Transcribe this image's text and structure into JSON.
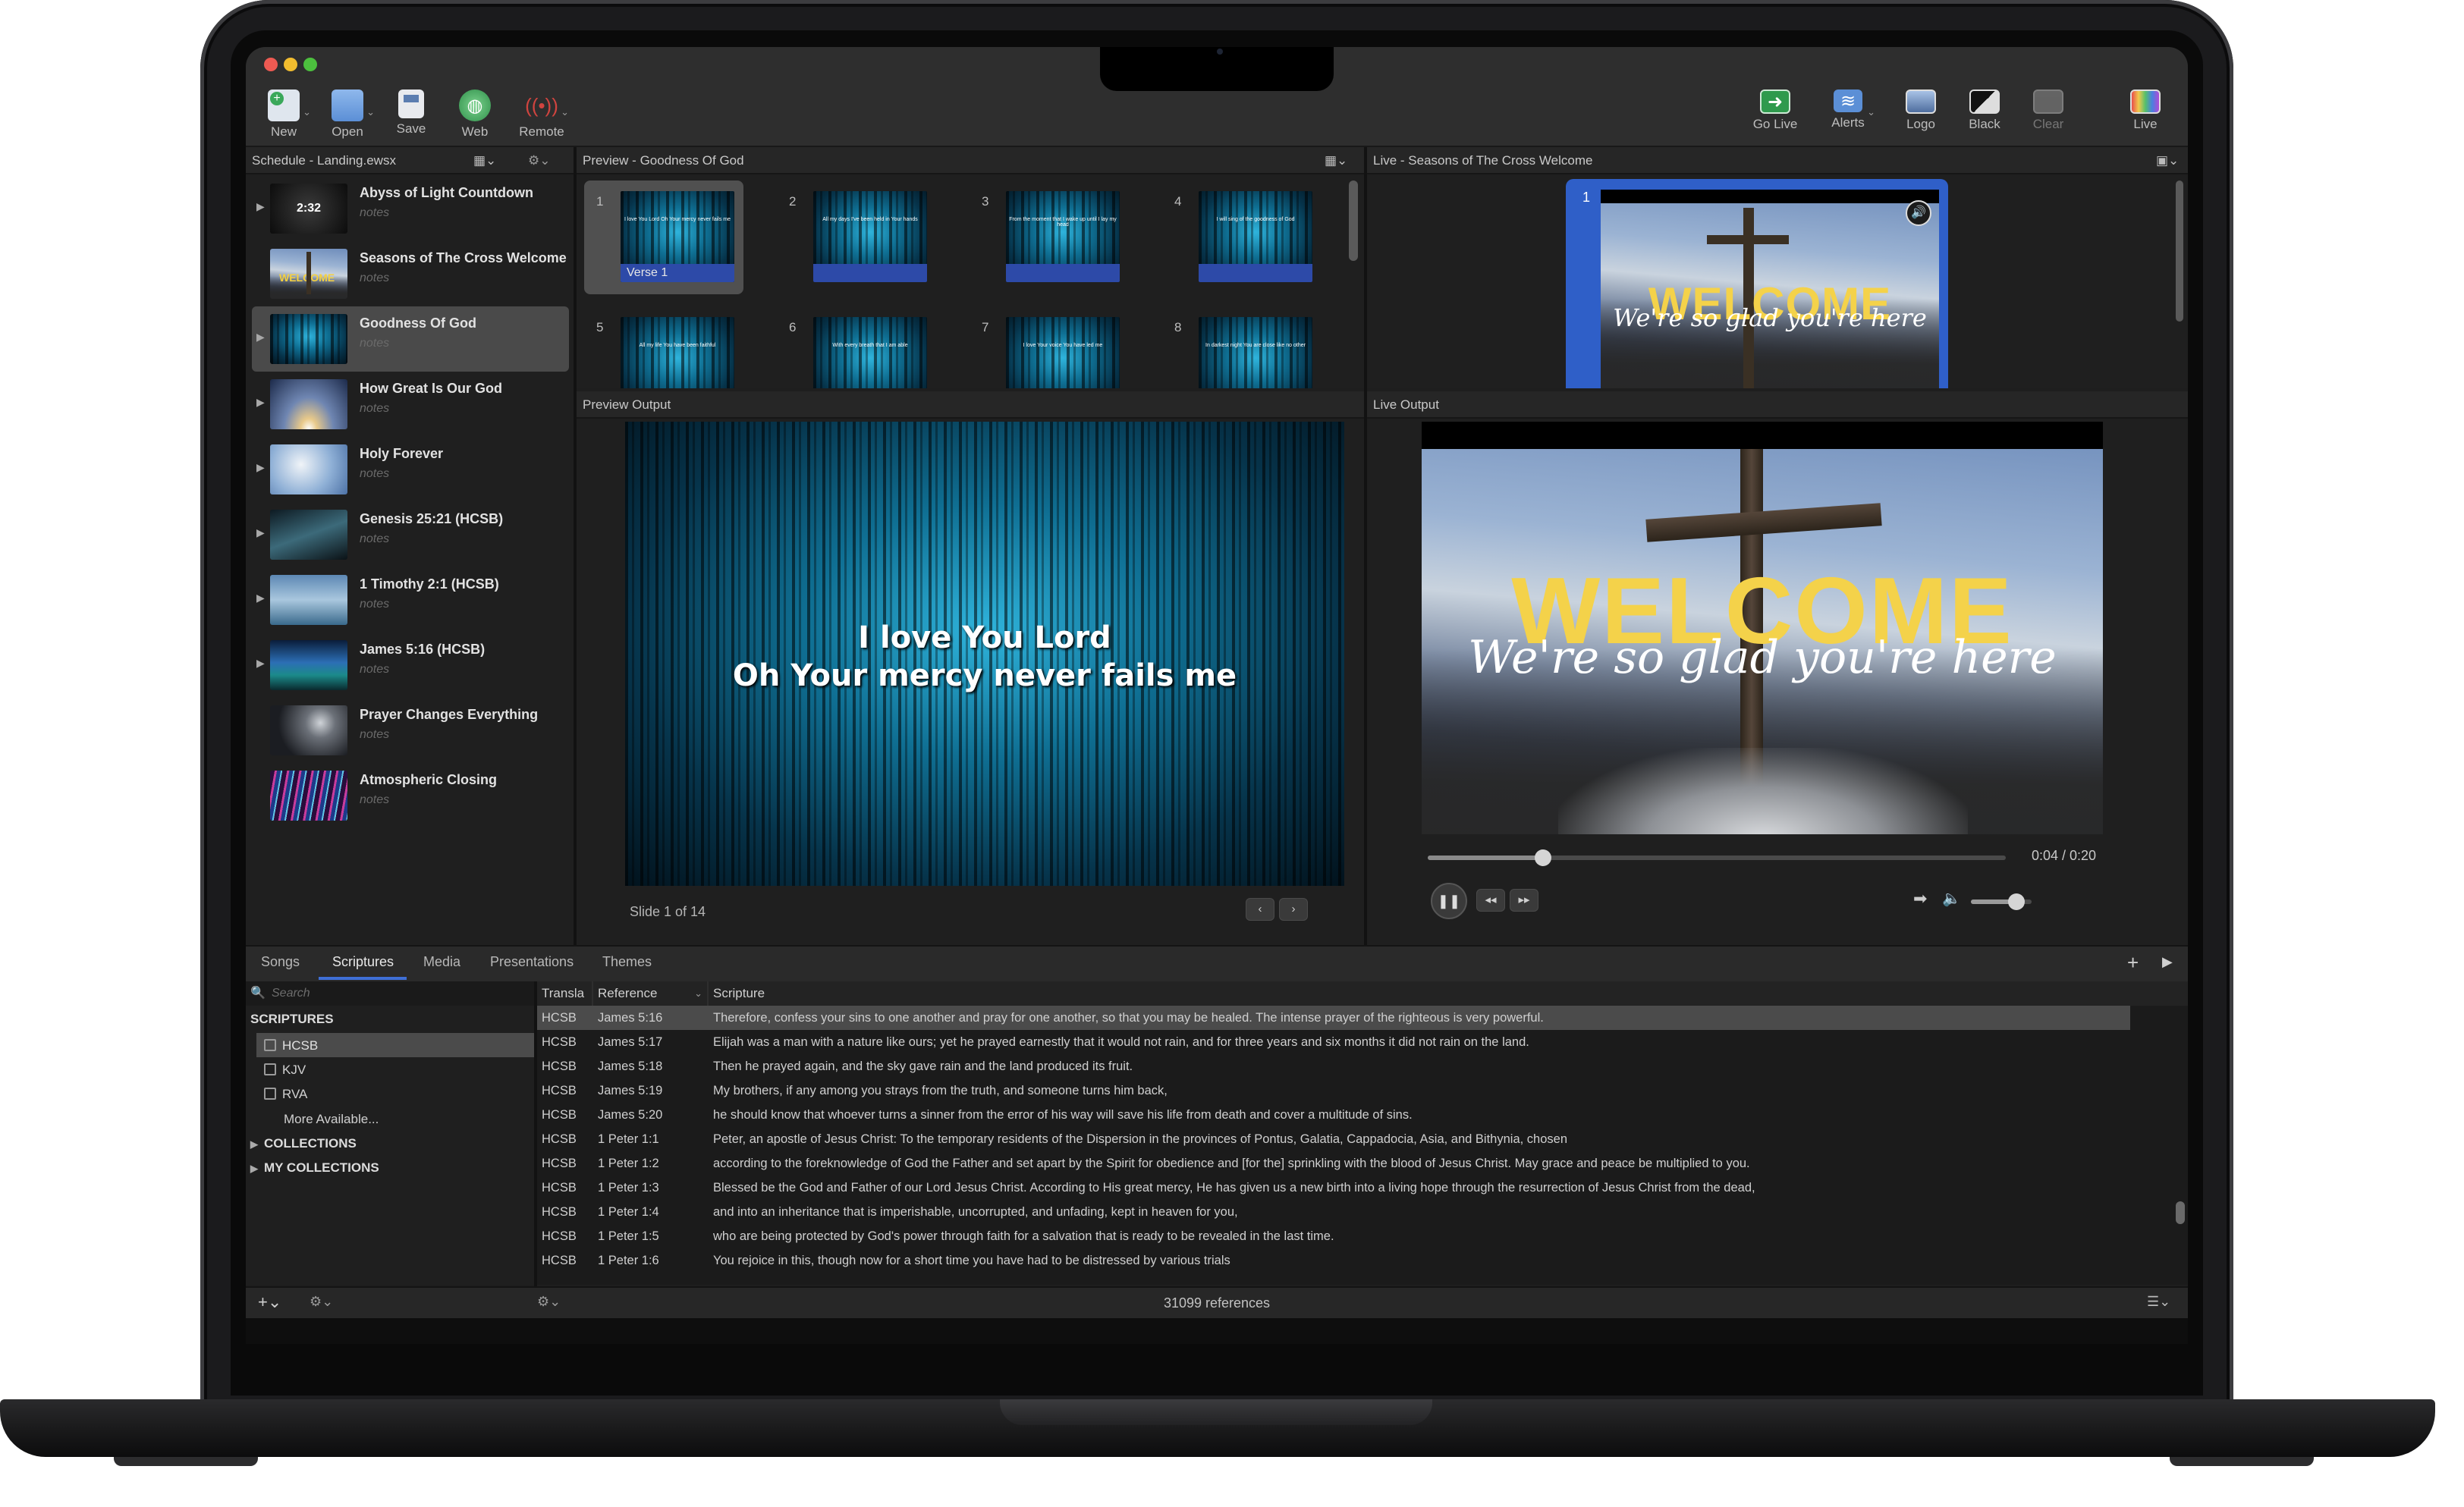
{
  "toolbar": {
    "left": [
      {
        "label": "New",
        "icon": "new-document-icon",
        "color": "#3aa85a"
      },
      {
        "label": "Open",
        "icon": "folder-icon",
        "color": "#5b8fd6"
      },
      {
        "label": "Save",
        "icon": "save-disk-icon",
        "color": "#7d8fb0"
      },
      {
        "label": "Web",
        "icon": "globe-icon",
        "color": "#3aa85a"
      },
      {
        "label": "Remote",
        "icon": "broadcast-icon",
        "color": "#d0443f"
      }
    ],
    "right": [
      {
        "label": "Go Live",
        "icon": "go-live-icon",
        "color": "#3aa85a"
      },
      {
        "label": "Alerts",
        "icon": "alerts-icon",
        "color": "#5b8fd6"
      },
      {
        "label": "Logo",
        "icon": "logo-icon",
        "color": "#6d88b6"
      },
      {
        "label": "Black",
        "icon": "black-screen-icon",
        "color": "#222222"
      },
      {
        "label": "Clear",
        "icon": "clear-icon",
        "color": "#777777"
      },
      {
        "label": "Live",
        "icon": "live-monitor-icon",
        "color": "#d04a8a"
      }
    ]
  },
  "schedule": {
    "title": "Schedule - Landing.ewsx",
    "items": [
      {
        "title": "Abyss of Light Countdown",
        "notes": "notes",
        "badge": "2:32"
      },
      {
        "title": "Seasons of The Cross Welcome",
        "notes": "notes",
        "badge": "WELCOME"
      },
      {
        "title": "Goodness Of God",
        "notes": "notes",
        "selected": true
      },
      {
        "title": "How Great Is Our God",
        "notes": "notes"
      },
      {
        "title": "Holy Forever",
        "notes": "notes"
      },
      {
        "title": "Genesis 25:21 (HCSB)",
        "notes": "notes"
      },
      {
        "title": "1 Timothy 2:1 (HCSB)",
        "notes": "notes"
      },
      {
        "title": "James 5:16 (HCSB)",
        "notes": "notes"
      },
      {
        "title": "Prayer Changes Everything",
        "notes": "notes"
      },
      {
        "title": "Atmospheric Closing",
        "notes": "notes"
      }
    ]
  },
  "preview": {
    "title": "Preview - Goodness Of God",
    "slides": [
      {
        "num": "1",
        "label": "Verse 1",
        "lyric": "I love You Lord Oh Your mercy never fails me"
      },
      {
        "num": "2",
        "label": "",
        "lyric": "All my days I've been held in Your hands"
      },
      {
        "num": "3",
        "label": "",
        "lyric": "From the moment that I wake up until I lay my head"
      },
      {
        "num": "4",
        "label": "",
        "lyric": "I will sing of the goodness of God"
      },
      {
        "num": "5",
        "label": "",
        "lyric": "All my life You have been faithful"
      },
      {
        "num": "6",
        "label": "",
        "lyric": "With every breath that I am able"
      },
      {
        "num": "7",
        "label": "",
        "lyric": "I love Your voice You have led me"
      },
      {
        "num": "8",
        "label": "",
        "lyric": "In darkest night You are close like no other"
      }
    ],
    "output_title": "Preview Output",
    "lyric_line1": "I love You Lord",
    "lyric_line2": "Oh Your mercy never fails me",
    "slide_counter": "Slide 1 of 14"
  },
  "live": {
    "title": "Live - Seasons of The Cross Welcome",
    "thumb_num": "1",
    "output_title": "Live Output",
    "welcome": "WELCOME",
    "subtitle": "We're so glad you're here",
    "time": "0:04 / 0:20",
    "progress": 0.2,
    "volume": 0.75
  },
  "library": {
    "tabs": [
      "Songs",
      "Scriptures",
      "Media",
      "Presentations",
      "Themes"
    ],
    "active_tab": "Scriptures",
    "search_placeholder": "Search",
    "scriptures_header": "SCRIPTURES",
    "translations": [
      "HCSB",
      "KJV",
      "RVA"
    ],
    "more_available": "More Available...",
    "collections": "COLLECTIONS",
    "my_collections": "MY COLLECTIONS",
    "columns": [
      "Transla",
      "Reference",
      "Scripture"
    ],
    "rows": [
      {
        "t": "HCSB",
        "ref": "James 5:16",
        "text": "Therefore, confess your sins to one another and pray for one another, so that you may be healed. The intense prayer of the righteous is very powerful."
      },
      {
        "t": "HCSB",
        "ref": "James 5:17",
        "text": "Elijah was a man with a nature like ours; yet he prayed earnestly that it would not rain, and for three years and six months it did not rain on the land."
      },
      {
        "t": "HCSB",
        "ref": "James 5:18",
        "text": "Then he prayed again, and the sky gave rain and the land produced its fruit."
      },
      {
        "t": "HCSB",
        "ref": "James 5:19",
        "text": "My brothers, if any among you strays from the truth, and someone turns him back,"
      },
      {
        "t": "HCSB",
        "ref": "James 5:20",
        "text": "he should know that whoever turns a sinner from the error of his way will save his life from death and cover a multitude of sins."
      },
      {
        "t": "HCSB",
        "ref": "1 Peter 1:1",
        "text": "Peter, an apostle of Jesus Christ: To the temporary residents of the Dispersion in the provinces of Pontus, Galatia, Cappadocia, Asia, and Bithynia, chosen"
      },
      {
        "t": "HCSB",
        "ref": "1 Peter 1:2",
        "text": "according to the foreknowledge of God the Father and set apart by the Spirit for obedience and [for the] sprinkling with the blood of Jesus Christ. May grace and peace be multiplied to you."
      },
      {
        "t": "HCSB",
        "ref": "1 Peter 1:3",
        "text": "Blessed be the God and Father of our Lord Jesus Christ. According to His great mercy, He has given us a new birth into a living hope through the resurrection of Jesus Christ from the dead,"
      },
      {
        "t": "HCSB",
        "ref": "1 Peter 1:4",
        "text": "and into an inheritance that is imperishable, uncorrupted, and unfading, kept in heaven for you,"
      },
      {
        "t": "HCSB",
        "ref": "1 Peter 1:5",
        "text": "who are being protected by God's power through faith for a salvation that is ready to be revealed in the last time."
      },
      {
        "t": "HCSB",
        "ref": "1 Peter 1:6",
        "text": "You rejoice in this, though now for a short time you have had to be distressed by various trials"
      }
    ],
    "count": "31099 references"
  }
}
